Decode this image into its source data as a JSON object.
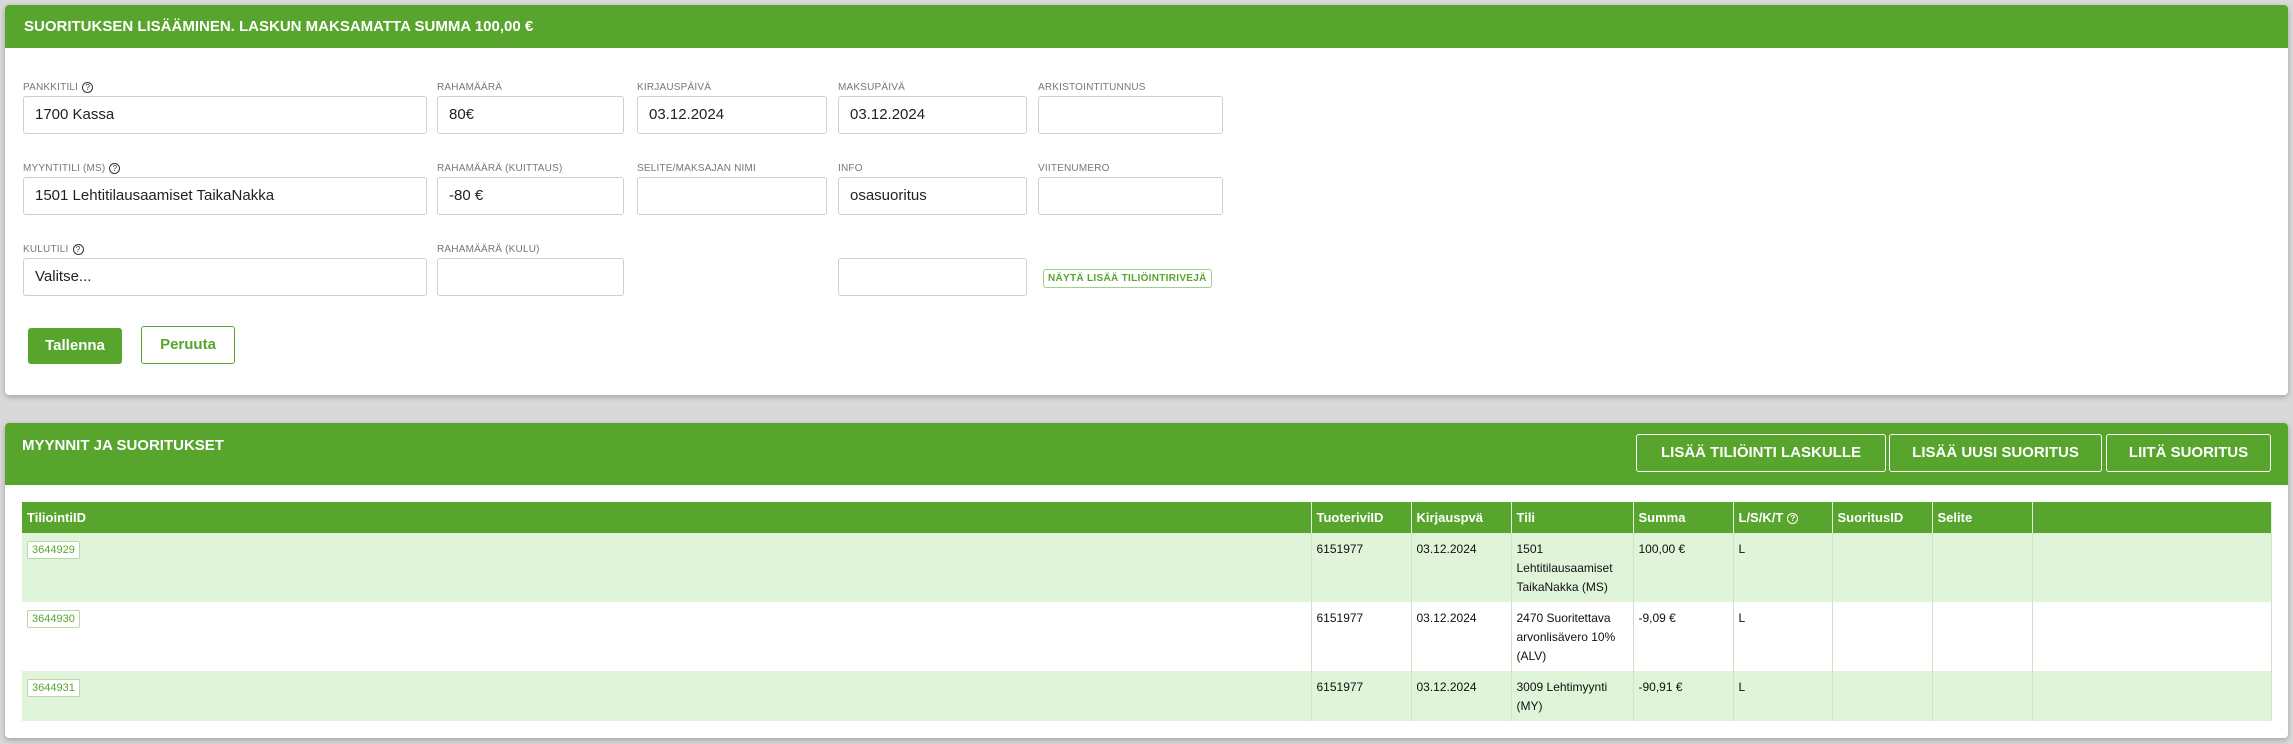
{
  "form_panel": {
    "title": "SUORITUKSEN LISÄÄMINEN. LASKUN MAKSAMATTA SUMMA 100,00 €",
    "fields": {
      "pankkitili": {
        "label": "PANKKITILI",
        "value": "1700 Kassa"
      },
      "rahamaara": {
        "label": "RAHAMÄÄRÄ",
        "value": "80€"
      },
      "kirjauspaiva": {
        "label": "KIRJAUSPÄIVÄ",
        "value": "03.12.2024"
      },
      "maksupaiva": {
        "label": "MAKSUPÄIVÄ",
        "value": "03.12.2024"
      },
      "arkistointitunnus": {
        "label": "ARKISTOINTITUNNUS",
        "value": ""
      },
      "myyntitili": {
        "label": "MYYNTITILI (MS)",
        "value": "1501 Lehtitilausaamiset TaikaNakka"
      },
      "rahamaara_kuittaus": {
        "label": "RAHAMÄÄRÄ (KUITTAUS)",
        "value": "-80 €"
      },
      "selite": {
        "label": "SELITE/MAKSAJAN NIMI",
        "value": ""
      },
      "info": {
        "label": "INFO",
        "value": "osasuoritus"
      },
      "viitenumero": {
        "label": "VIITENUMERO",
        "value": ""
      },
      "kulutili": {
        "label": "KULUTILI",
        "value": "Valitse..."
      },
      "rahamaara_kulu": {
        "label": "RAHAMÄÄRÄ (KULU)",
        "value": ""
      },
      "extra": {
        "value": ""
      }
    },
    "help_glyph": "?",
    "show_more_label": "NÄYTÄ LISÄÄ TILIÖINTIRIVEJÄ",
    "save_label": "Tallenna",
    "cancel_label": "Peruuta"
  },
  "list_panel": {
    "title": "MYYNNIT JA SUORITUKSET",
    "buttons": {
      "add_posting": "LISÄÄ TILIÖINTI LASKULLE",
      "add_payment": "LISÄÄ UUSI SUORITUS",
      "attach_payment": "LIITÄ SUORITUS"
    },
    "columns": [
      "TiliointiID",
      "TuoteriviID",
      "Kirjauspvä",
      "Tili",
      "Summa",
      "L/S/K/T",
      "SuoritusID",
      "Selite",
      ""
    ],
    "rows": [
      {
        "id": "3644929",
        "tuoterivi": "6151977",
        "pvm": "03.12.2024",
        "tili": "1501 Lehtitilausaamiset TaikaNakka (MS)",
        "summa": "100,00 €",
        "lskt": "L",
        "suoritus": "",
        "selite": ""
      },
      {
        "id": "3644930",
        "tuoterivi": "6151977",
        "pvm": "03.12.2024",
        "tili": "2470 Suoritettava arvonlisävero 10% (ALV)",
        "summa": "-9,09 €",
        "lskt": "L",
        "suoritus": "",
        "selite": ""
      },
      {
        "id": "3644931",
        "tuoterivi": "6151977",
        "pvm": "03.12.2024",
        "tili": "3009 Lehtimyynti (MY)",
        "summa": "-90,91 €",
        "lskt": "L",
        "suoritus": "",
        "selite": ""
      }
    ]
  },
  "colors": {
    "brand_green": "#57a52d",
    "row_tint": "#dff4d8"
  }
}
